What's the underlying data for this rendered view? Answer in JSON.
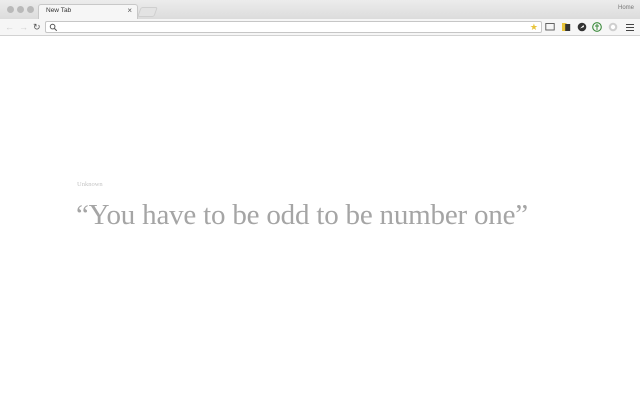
{
  "window": {
    "profile_name": "Home"
  },
  "tabs": [
    {
      "title": "New Tab",
      "close_glyph": "×"
    }
  ],
  "toolbar": {
    "back_glyph": "←",
    "forward_glyph": "→",
    "reload_glyph": "↻",
    "address_value": "",
    "bookmark_glyph": "★",
    "bookmark_color": "#e8c43a"
  },
  "icons": [
    "search-icon",
    "star-icon",
    "cast-icon",
    "extension-icon",
    "menu-icon"
  ],
  "page": {
    "quote_author": "Unknown",
    "quote_text": "“You have to be odd to be number one”"
  }
}
